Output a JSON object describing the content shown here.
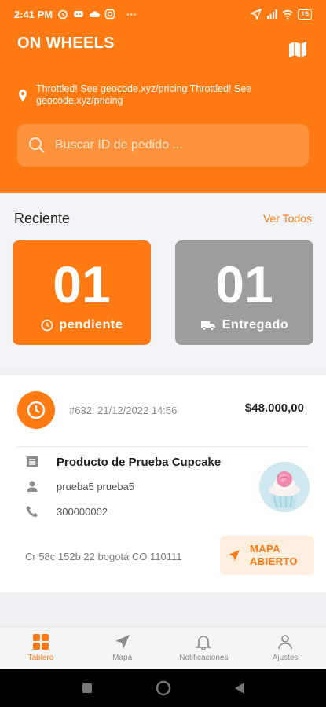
{
  "status_bar": {
    "time": "2:41 PM",
    "more": "···",
    "battery": "15"
  },
  "header": {
    "app_title": "ON WHEELS",
    "location_text": "Throttled! See geocode.xyz/pricing Throttled! See geocode.xyz/pricing",
    "search_placeholder": "Buscar ID de pedido ..."
  },
  "recent": {
    "title": "Reciente",
    "see_all": "Ver Todos",
    "pending": {
      "count": "01",
      "label": "pendiente"
    },
    "delivered": {
      "count": "01",
      "label": "Entregado"
    }
  },
  "order": {
    "id_date": "#632: 21/12/2022 14:56",
    "amount": "$48.000,00",
    "product": "Producto de Prueba Cupcake",
    "customer": "prueba5 prueba5",
    "phone": "300000002",
    "address": "Cr 58c 152b 22 bogotá CO 110111",
    "open_map": "MAPA ABIERTO"
  },
  "bottom_nav": [
    {
      "label": "Tablero",
      "icon": "dashboard-icon",
      "active": true
    },
    {
      "label": "Mapa",
      "icon": "navigation-icon",
      "active": false
    },
    {
      "label": "Notificaciones",
      "icon": "bell-icon",
      "active": false
    },
    {
      "label": "Ajustes",
      "icon": "user-icon",
      "active": false
    }
  ],
  "colors": {
    "accent": "#ff7a12",
    "delivered_card": "#9d9d9d"
  }
}
